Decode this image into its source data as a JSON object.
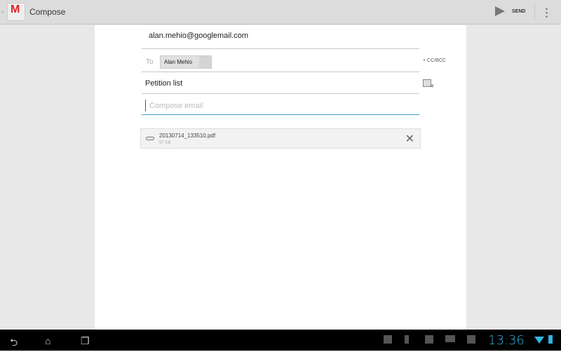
{
  "actionbar": {
    "title": "Compose",
    "send_label": "SEND"
  },
  "compose": {
    "from": "alan.mehio@googlemail.com",
    "to_label": "To",
    "recipient": "Alan Mehio",
    "cc_bcc": "+ CC/BCC",
    "subject": "Petition list",
    "body_placeholder": "Compose email",
    "body_value": ""
  },
  "attachment": {
    "filename": "20130714_133510.pdf",
    "size": "57 KB"
  },
  "statusbar": {
    "time": "13:36",
    "accent": "#33b5e5"
  }
}
